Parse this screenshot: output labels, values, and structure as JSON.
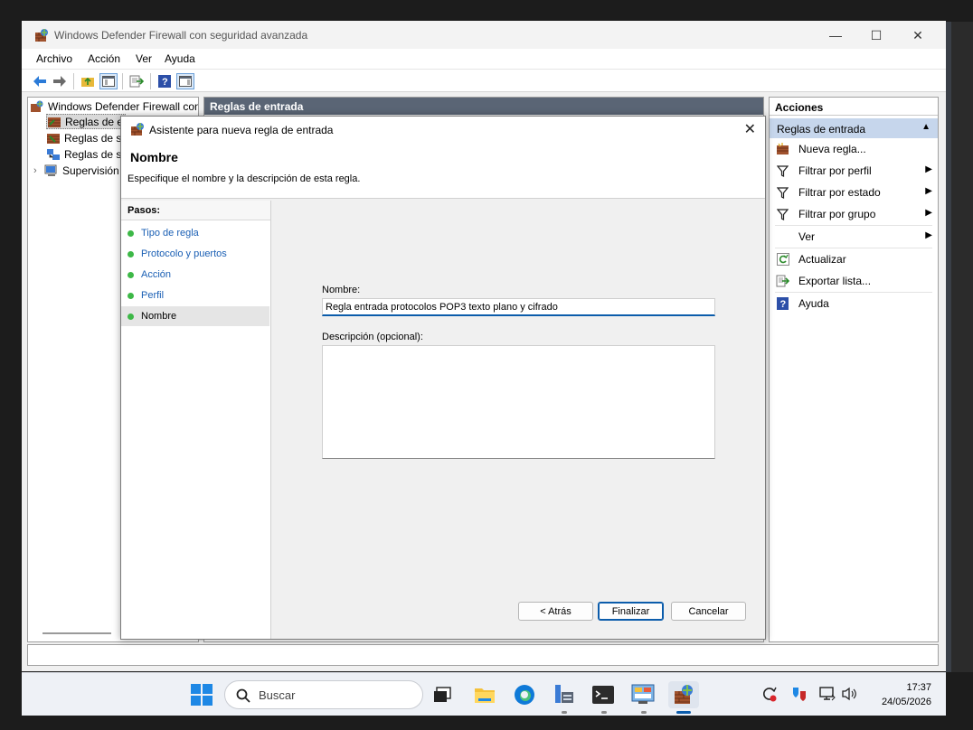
{
  "window": {
    "title": "Windows Defender Firewall con seguridad avanzada",
    "controls": {
      "minimize": "—",
      "maximize": "☐",
      "close": "✕"
    }
  },
  "menu": [
    "Archivo",
    "Acción",
    "Ver",
    "Ayuda"
  ],
  "tree": {
    "root": "Windows Defender Firewall con",
    "items": [
      "Reglas de e",
      "Reglas de s",
      "Reglas de s",
      "Supervisión"
    ]
  },
  "center": {
    "header": "Reglas de entrada"
  },
  "actions": {
    "header": "Acciones",
    "section": "Reglas de entrada",
    "items": [
      {
        "label": "Nueva regla...",
        "icon": "new-rule-icon"
      },
      {
        "label": "Filtrar por perfil",
        "icon": "filter-icon"
      },
      {
        "label": "Filtrar por estado",
        "icon": "filter-icon"
      },
      {
        "label": "Filtrar por grupo",
        "icon": "filter-icon"
      },
      {
        "label": "Ver",
        "icon": ""
      },
      {
        "label": "Actualizar",
        "icon": "refresh-icon"
      },
      {
        "label": "Exportar lista...",
        "icon": "export-icon"
      },
      {
        "label": "Ayuda",
        "icon": "help-icon"
      }
    ]
  },
  "dialog": {
    "title": "Asistente para nueva regla de entrada",
    "heading": "Nombre",
    "subheading": "Especifique el nombre y la descripción de esta regla.",
    "steps_header": "Pasos:",
    "steps": [
      "Tipo de regla",
      "Protocolo y puertos",
      "Acción",
      "Perfil",
      "Nombre"
    ],
    "active_step": "Nombre",
    "name_label": "Nombre:",
    "name_value": "Regla entrada protocolos POP3 texto plano y cifrado",
    "desc_label": "Descripción (opcional):",
    "desc_value": "",
    "buttons": {
      "back": "< Atrás",
      "finish": "Finalizar",
      "cancel": "Cancelar"
    }
  },
  "taskbar": {
    "search_placeholder": "Buscar",
    "time": "17:37",
    "date": "24/05/2026"
  },
  "colors": {
    "accent": "#0b5cab",
    "panel_header": "#5a6575",
    "actions_section": "#c6d6ec",
    "step_done": "#3db847"
  }
}
